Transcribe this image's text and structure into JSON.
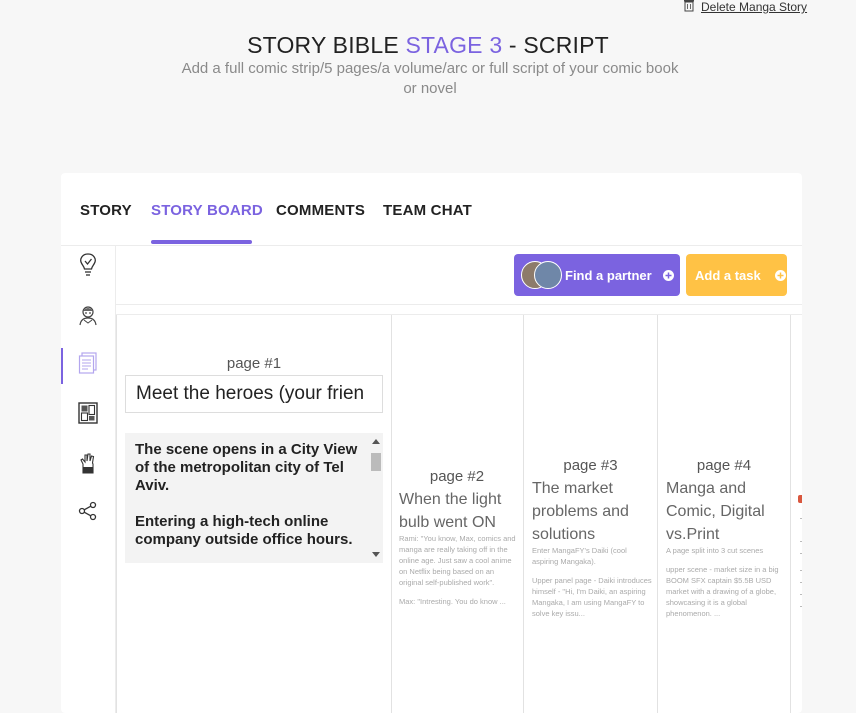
{
  "header": {
    "delete_label": "Delete Manga Story",
    "title_prefix": "STORY BIBLE ",
    "title_stage": "STAGE 3",
    "title_suffix": " - SCRIPT",
    "subtitle": "Add a full comic strip/5 pages/a volume/arc or full script of your comic book or novel"
  },
  "tabs": [
    {
      "label": "STORY",
      "active": false
    },
    {
      "label": "STORY BOARD",
      "active": true
    },
    {
      "label": "COMMENTS",
      "active": false
    },
    {
      "label": "TEAM CHAT",
      "active": false
    }
  ],
  "sidebar": {
    "icons": [
      "lightbulb-check-icon",
      "characters-icon",
      "script-pages-icon",
      "storyboard-grid-icon",
      "hand-tools-icon",
      "share-icon"
    ],
    "active_index": 2
  },
  "toolbar": {
    "find_partner_label": "Find a partner",
    "add_task_label": "Add a task"
  },
  "pages": [
    {
      "page_label": "page #1",
      "title": "Meet the heroes (your frien",
      "description": [
        "The scene opens in a City View of the metropolitan city of Tel Aviv.",
        "Entering a high-tech online company outside office hours."
      ]
    },
    {
      "page_label": "page #2",
      "title": "When the light bulb went ON",
      "text": [
        "Rami: \"You know, Max, comics and manga are really taking off in the online age. Just saw a cool anime on Netflix being based on an original self-published work\".",
        "Max: \"Intresting. You do know ..."
      ]
    },
    {
      "page_label": "page #3",
      "title": "The market problems and solutions",
      "text": [
        "Enter MangaFY's Daiki (cool aspiring Mangaka).",
        "Upper panel page - Daiki introduces himself - \"Hi, I'm Daiki, an aspiring Mangaka, I am using MangaFY to solve key issu..."
      ]
    },
    {
      "page_label": "page #4",
      "title": "Manga and Comic, Digital vs.Print",
      "text": [
        "A page split into 3 cut scenes",
        "upper scene - market size in a big BOOM SFX captain $5.5B USD market with a drawing of a globe, showcasing it is a global phenomenon. ..."
      ]
    }
  ],
  "colors": {
    "accent": "#7b63e0",
    "add_task": "#ffc245"
  }
}
